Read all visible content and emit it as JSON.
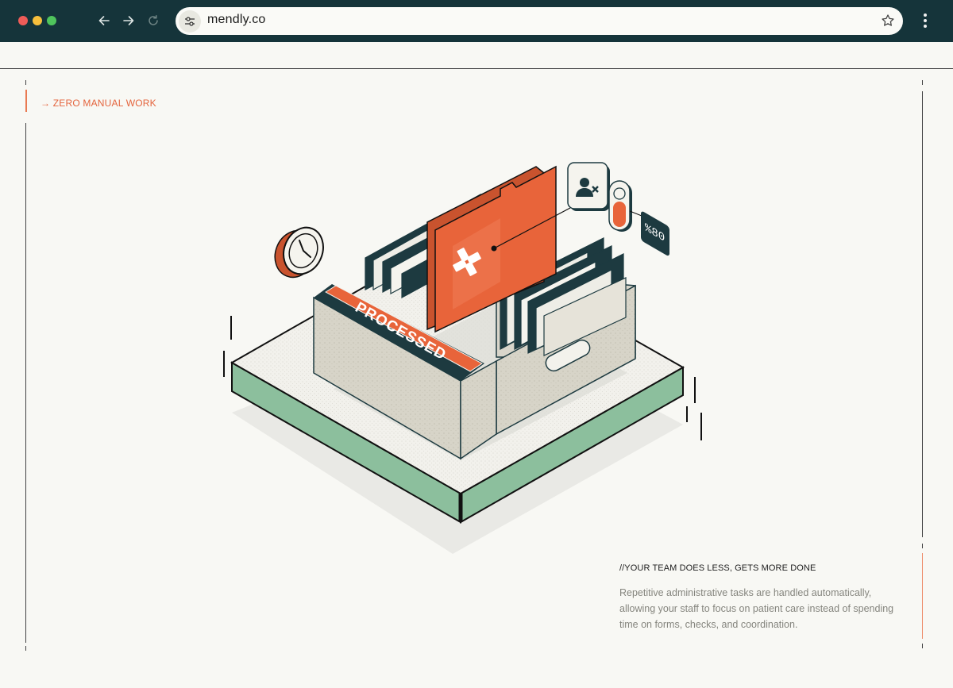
{
  "browser": {
    "url": "mendly.co",
    "icons": {
      "back": "arrow-left-icon",
      "forward": "arrow-right-icon",
      "reload": "reload-icon",
      "site_settings": "tune-icon",
      "bookmark": "star-icon",
      "menu": "more-vertical-icon"
    }
  },
  "section": {
    "tag": "→ ZERO MANUAL WORK",
    "subheading": "//YOUR TEAM DOES LESS, GETS MORE DONE",
    "body": "Repetitive administrative tasks are handled automatically, allowing your staff to focus on patient care instead of spending time on forms, checks, and coordination."
  },
  "illustration": {
    "label_processed": "PROCESSED",
    "percent_badge": "%80"
  },
  "colors": {
    "chrome": "#15343a",
    "accent_orange": "#e8643a",
    "base_green": "#8cbf9d",
    "dark_teal": "#1d3a40",
    "background": "#f8f8f4"
  }
}
